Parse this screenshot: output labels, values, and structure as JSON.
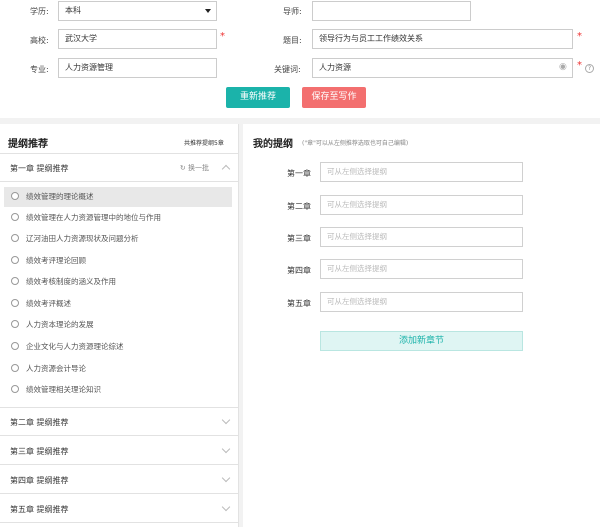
{
  "form": {
    "education_label": "学历:",
    "education_value": "本科",
    "advisor_label": "导师:",
    "advisor_value": "",
    "school_label": "高校:",
    "school_value": "武汉大学",
    "title_label": "题目:",
    "title_value": "领导行为与员工工作绩效关系",
    "major_label": "专业:",
    "major_value": "人力资源管理",
    "keywords_label": "关键词:",
    "keywords_value": "人力资源",
    "required_mark": "*",
    "help_mark": "?"
  },
  "actions": {
    "recommend_label": "重新推荐",
    "save_label": "保存至写作"
  },
  "outline_recommend": {
    "title": "提纲推荐",
    "count_text": "共推荐提纲5章",
    "refresh_label": "换一批",
    "sections": [
      {
        "title": "第一章  提纲推荐"
      },
      {
        "title": "第二章  提纲推荐"
      },
      {
        "title": "第三章  提纲推荐"
      },
      {
        "title": "第四章  提纲推荐"
      },
      {
        "title": "第五章  提纲推荐"
      }
    ],
    "items": [
      "绩效管理的理论概述",
      "绩效管理在人力资源管理中的地位与作用",
      "辽河油田人力资源现状及问题分析",
      "绩效考评理论回顾",
      "绩效考核制度的涵义及作用",
      "绩效考评概述",
      "人力资本理论的发展",
      "企业文化与人力资源理论综述",
      "人力资源会计导论",
      "绩效管理相关理论知识"
    ]
  },
  "my_outline": {
    "title": "我的提纲",
    "hint": "(\"章\"可以从左侧推荐选取也可自己编辑)",
    "chapters": [
      {
        "label": "第一章",
        "placeholder": "可从左侧选择提纲"
      },
      {
        "label": "第二章",
        "placeholder": "可从左侧选择提纲"
      },
      {
        "label": "第三章",
        "placeholder": "可从左侧选择提纲"
      },
      {
        "label": "第四章",
        "placeholder": "可从左侧选择提纲"
      },
      {
        "label": "第五章",
        "placeholder": "可从左侧选择提纲"
      }
    ],
    "add_label": "添加新章节"
  },
  "colors": {
    "accent_teal": "#1bb3aa",
    "accent_red": "#f36f6f",
    "required": "#e33333"
  }
}
